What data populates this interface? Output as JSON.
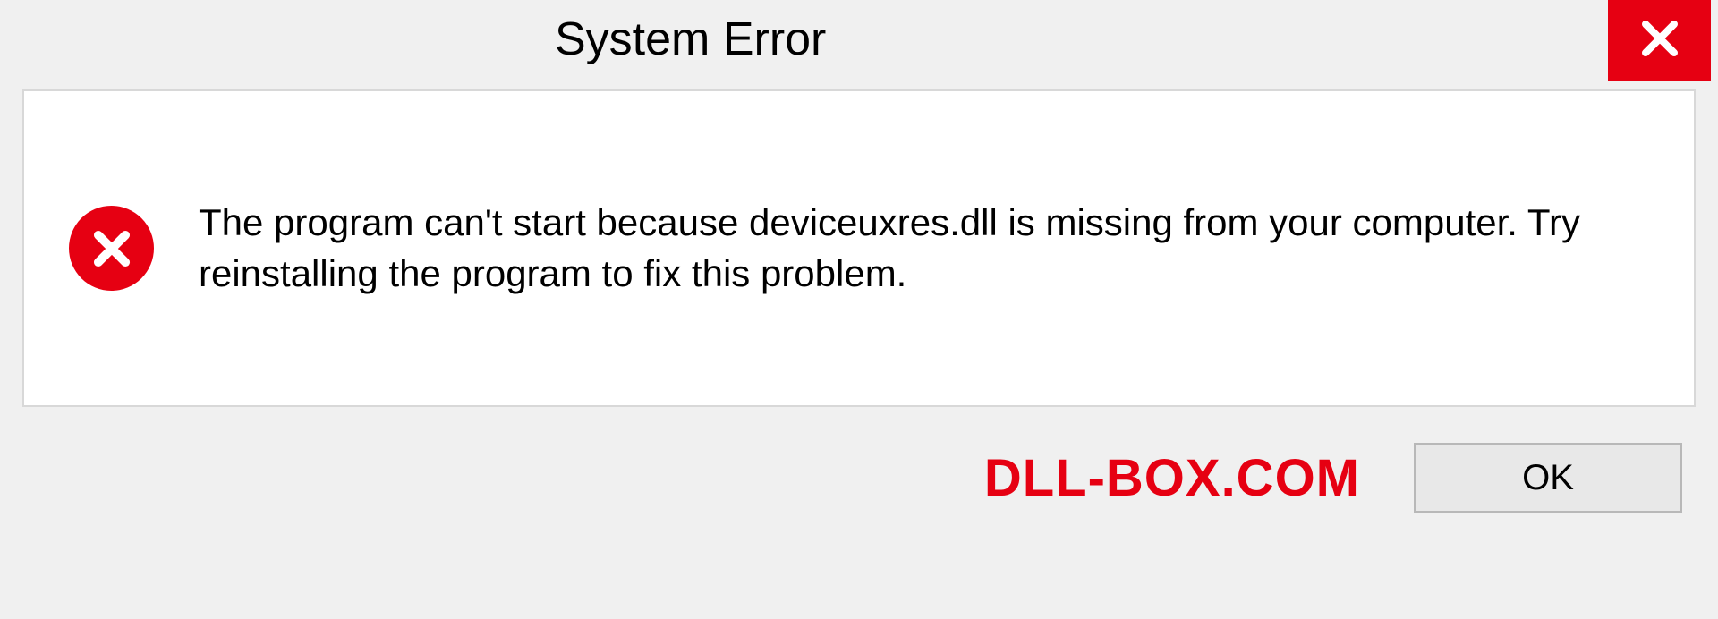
{
  "dialog": {
    "title": "System Error",
    "message": "The program can't start because deviceuxres.dll is missing from your computer. Try reinstalling the program to fix this problem.",
    "ok_label": "OK",
    "watermark": "DLL-BOX.COM"
  }
}
